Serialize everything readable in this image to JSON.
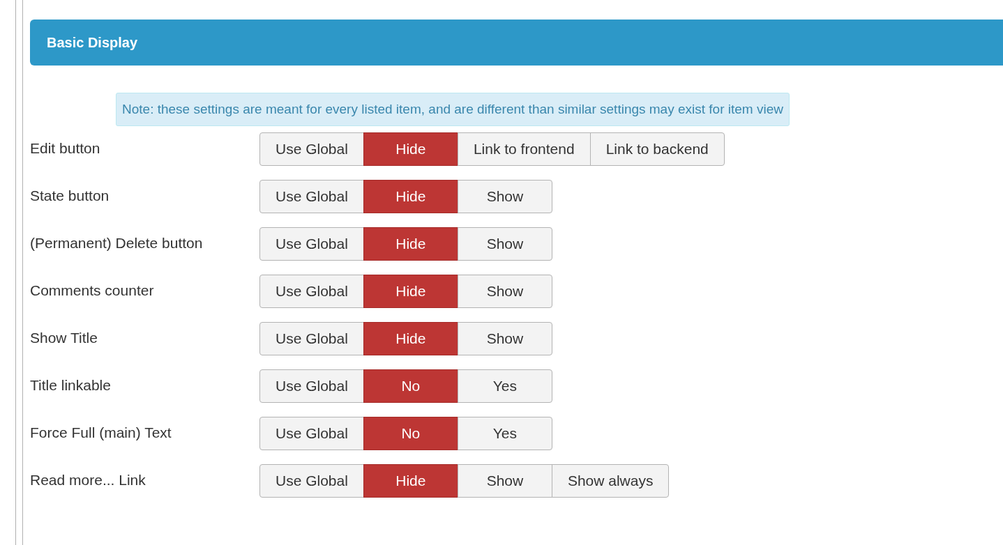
{
  "panel": {
    "title": "Basic Display"
  },
  "note": "Note: these settings are meant for every listed item, and are different than similar settings may exist for item view",
  "settings": [
    {
      "label": "Edit button",
      "options": [
        {
          "label": "Use Global",
          "selected": false
        },
        {
          "label": "Hide",
          "selected": true
        },
        {
          "label": "Link to frontend",
          "selected": false
        },
        {
          "label": "Link to backend",
          "selected": false
        }
      ]
    },
    {
      "label": "State button",
      "options": [
        {
          "label": "Use Global",
          "selected": false
        },
        {
          "label": "Hide",
          "selected": true
        },
        {
          "label": "Show",
          "selected": false
        }
      ]
    },
    {
      "label": "(Permanent) Delete button",
      "options": [
        {
          "label": "Use Global",
          "selected": false
        },
        {
          "label": "Hide",
          "selected": true
        },
        {
          "label": "Show",
          "selected": false
        }
      ]
    },
    {
      "label": "Comments counter",
      "options": [
        {
          "label": "Use Global",
          "selected": false
        },
        {
          "label": "Hide",
          "selected": true
        },
        {
          "label": "Show",
          "selected": false
        }
      ]
    },
    {
      "label": "Show Title",
      "options": [
        {
          "label": "Use Global",
          "selected": false
        },
        {
          "label": "Hide",
          "selected": true
        },
        {
          "label": "Show",
          "selected": false
        }
      ]
    },
    {
      "label": "Title linkable",
      "options": [
        {
          "label": "Use Global",
          "selected": false
        },
        {
          "label": "No",
          "selected": true
        },
        {
          "label": "Yes",
          "selected": false
        }
      ]
    },
    {
      "label": "Force Full (main) Text",
      "options": [
        {
          "label": "Use Global",
          "selected": false
        },
        {
          "label": "No",
          "selected": true
        },
        {
          "label": "Yes",
          "selected": false
        }
      ]
    },
    {
      "label": "Read more... Link",
      "options": [
        {
          "label": "Use Global",
          "selected": false
        },
        {
          "label": "Hide",
          "selected": true
        },
        {
          "label": "Show",
          "selected": false
        },
        {
          "label": "Show always",
          "selected": false
        }
      ]
    }
  ]
}
